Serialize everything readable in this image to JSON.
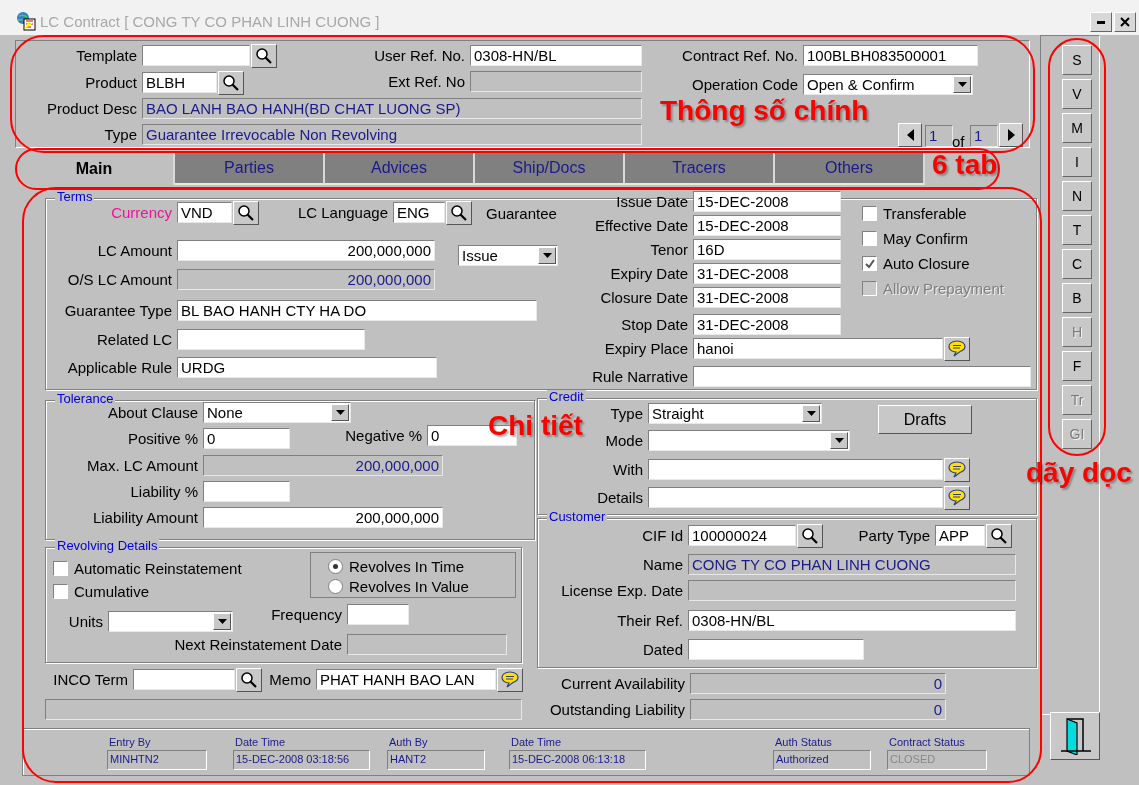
{
  "window": {
    "title": "LC Contract  [ CONG TY CO PHAN LINH CUONG ]"
  },
  "header": {
    "fields": [
      {
        "label": "Template",
        "kind": "lookup"
      },
      {
        "label": "Product",
        "kind": "lookup",
        "value": "BLBH"
      },
      {
        "label": "Product Desc",
        "kind": "readonly",
        "value": "BAO LANH BAO HANH(BD CHAT LUONG SP)"
      },
      {
        "label": "Type",
        "kind": "readonly",
        "value": "Guarantee  Irrevocable  Non Revolving"
      },
      {
        "label": "User Ref. No.",
        "kind": "text",
        "value": "0308-HN/BL"
      },
      {
        "label": "Ext Ref. No",
        "kind": "readonly"
      },
      {
        "label": "Contract Ref. No.",
        "kind": "text",
        "value": "100BLBH083500001"
      },
      {
        "label": "Operation Code",
        "kind": "select",
        "value": "Open & Confirm"
      }
    ],
    "pager": {
      "current": "1",
      "of": "of",
      "total": "1"
    }
  },
  "tabs": [
    {
      "label": "Main",
      "selected": true
    },
    {
      "label": "Parties",
      "selected": false
    },
    {
      "label": "Advices",
      "selected": false
    },
    {
      "label": "Ship/Docs",
      "selected": false
    },
    {
      "label": "Tracers",
      "selected": false
    },
    {
      "label": "Others",
      "selected": false
    }
  ],
  "side_buttons": [
    {
      "label": "S",
      "disabled": false
    },
    {
      "label": "V",
      "disabled": false
    },
    {
      "label": "M",
      "disabled": false
    },
    {
      "label": "I",
      "disabled": false
    },
    {
      "label": "N",
      "disabled": false
    },
    {
      "label": "T",
      "disabled": false
    },
    {
      "label": "C",
      "disabled": false
    },
    {
      "label": "B",
      "disabled": false
    },
    {
      "label": "H",
      "disabled": true
    },
    {
      "label": "F",
      "disabled": false
    },
    {
      "label": "Tr",
      "disabled": true
    },
    {
      "label": "GI",
      "disabled": true
    }
  ],
  "terms": {
    "title": "Terms",
    "note": "Guarantee",
    "fields": [
      {
        "label": "Currency",
        "kind": "lookup",
        "value": "VND",
        "required": true
      },
      {
        "label": "LC Language",
        "kind": "lookup",
        "value": "ENG",
        "required": false
      },
      {
        "label": "LC Amount",
        "kind": "amount",
        "value": "200,000,000",
        "required": false
      },
      {
        "kind": "select",
        "value": "Issue"
      },
      {
        "label": "O/S LC Amount",
        "kind": "readonly_amount",
        "value": "200,000,000",
        "required": false
      },
      {
        "label": "Guarantee Type",
        "kind": "text",
        "value": "BL BAO HANH CTY HA DO",
        "required": false
      },
      {
        "label": "Related LC",
        "kind": "text",
        "required": false
      },
      {
        "label": "Applicable Rule",
        "kind": "text",
        "value": "URDG",
        "required": false
      },
      {
        "label": "Issue Date",
        "kind": "text",
        "value": "15-DEC-2008",
        "required": false
      },
      {
        "label": "Effective Date",
        "kind": "text",
        "value": "15-DEC-2008",
        "required": false
      },
      {
        "label": "Tenor",
        "kind": "text",
        "value": "16D",
        "required": false
      },
      {
        "label": "Expiry Date",
        "kind": "text",
        "value": "31-DEC-2008",
        "required": false
      },
      {
        "label": "Closure Date",
        "kind": "text",
        "value": "31-DEC-2008",
        "required": false
      },
      {
        "label": "Stop Date",
        "kind": "text",
        "value": "31-DEC-2008",
        "required": false
      },
      {
        "label": "Expiry Place",
        "kind": "note",
        "value": "hanoi",
        "required": false
      },
      {
        "label": "Rule Narrative",
        "kind": "text",
        "required": false
      }
    ],
    "checkboxes": [
      {
        "label": "Transferable",
        "checked": false,
        "disabled": false
      },
      {
        "label": "May  Confirm",
        "checked": false,
        "disabled": false
      },
      {
        "label": "Auto Closure",
        "checked": true,
        "disabled": false
      },
      {
        "label": "Allow Prepayment",
        "checked": false,
        "disabled": true
      }
    ]
  },
  "tolerance": {
    "title": "Tolerance",
    "fields": [
      {
        "label": "About Clause",
        "kind": "select",
        "value": "None"
      },
      {
        "label": "Positive %",
        "kind": "text",
        "value": "0"
      },
      {
        "label": "Negative %",
        "kind": "text",
        "value": "0"
      },
      {
        "label": "Max. LC Amount",
        "kind": "readonly_amount",
        "value": "200,000,000"
      },
      {
        "label": "Liability %",
        "kind": "text"
      },
      {
        "label": "Liability Amount",
        "kind": "amount",
        "value": "200,000,000"
      }
    ]
  },
  "credit": {
    "title": "Credit",
    "button": "Drafts",
    "fields": [
      {
        "label": "Type",
        "kind": "select",
        "value": "Straight"
      },
      {
        "label": "Mode",
        "kind": "select"
      },
      {
        "label": "With",
        "kind": "note"
      },
      {
        "label": "Details",
        "kind": "note"
      }
    ]
  },
  "customer": {
    "title": "Customer",
    "fields": [
      {
        "label": "CIF Id",
        "kind": "lookup",
        "value": "100000024"
      },
      {
        "label": "Party Type",
        "kind": "lookup",
        "value": "APP"
      },
      {
        "label": "Name",
        "kind": "readonly",
        "value": "CONG TY CO PHAN LINH CUONG"
      },
      {
        "label": "License Exp. Date",
        "kind": "readonly"
      },
      {
        "label": "Their Ref.",
        "kind": "text",
        "value": "0308-HN/BL"
      },
      {
        "label": "Dated",
        "kind": "text"
      }
    ]
  },
  "revolving": {
    "title": "Revolving Details",
    "checkboxes": [
      {
        "label": "Automatic Reinstatement",
        "checked": false,
        "disabled": false
      },
      {
        "label": "Cumulative",
        "checked": false,
        "disabled": false
      }
    ],
    "radios": [
      {
        "label": "Revolves In Time",
        "selected": true
      },
      {
        "label": "Revolves In Value",
        "selected": false
      }
    ],
    "fields": [
      {
        "label": "Units",
        "kind": "select"
      },
      {
        "label": "Frequency",
        "kind": "text"
      },
      {
        "label": "Next Reinstatement Date",
        "kind": "readonly"
      }
    ]
  },
  "bottom": {
    "fields": [
      {
        "label": "INCO Term",
        "kind": "lookup"
      },
      {
        "label": "Memo",
        "kind": "note",
        "value": "PHAT HANH BAO LAN"
      },
      {
        "kind": "readonly"
      }
    ]
  },
  "totals": {
    "fields": [
      {
        "label": "Current Availability",
        "kind": "readonly_amount",
        "value": "0"
      },
      {
        "label": "Outstanding Liability",
        "kind": "readonly_amount",
        "value": "0"
      }
    ]
  },
  "audit": [
    {
      "label": "Entry By",
      "value": "MINHTN2",
      "disabled": false
    },
    {
      "label": "Date Time",
      "value": "15-DEC-2008 03:18:56",
      "disabled": false
    },
    {
      "label": "Auth By",
      "value": "HANT2",
      "disabled": false
    },
    {
      "label": "Date Time",
      "value": "15-DEC-2008 06:13:18",
      "disabled": false
    },
    {
      "label": "Auth Status",
      "value": "Authorized",
      "disabled": false
    },
    {
      "label": "Contract Status",
      "value": "CLOSED",
      "disabled": true
    }
  ],
  "annotations": [
    {
      "text": "Thông số chính"
    },
    {
      "text": "6 tab"
    },
    {
      "text": "dãy dọc"
    },
    {
      "text": "Chi tiết"
    }
  ]
}
